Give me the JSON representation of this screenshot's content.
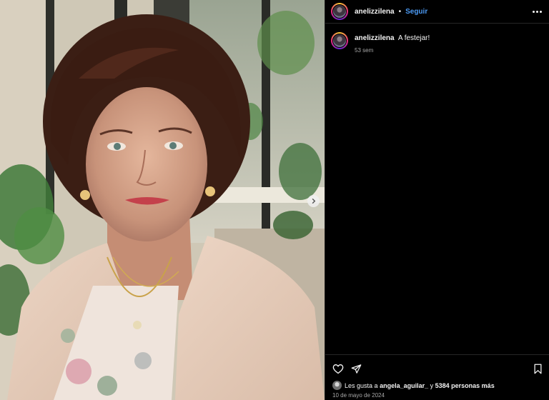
{
  "post": {
    "username": "anelizzilena",
    "separator": "•",
    "follow_label": "Seguir",
    "more_icon": "more-options-icon",
    "caption": {
      "username": "anelizzilena",
      "text": "A festejar!",
      "time": "53 sem"
    },
    "actions": {
      "like_icon": "heart-icon",
      "share_icon": "send-icon",
      "save_icon": "bookmark-icon"
    },
    "likes": {
      "prefix": "Les gusta a",
      "user": "angela_aguilar_",
      "middle": "y",
      "others": "5384 personas más"
    },
    "date": "10 de mayo de 2024"
  },
  "carousel": {
    "next_icon": "chevron-right-icon"
  },
  "colors": {
    "background": "#000000",
    "link_blue": "#4c9bf5",
    "secondary_text": "#a8a8a8",
    "divider": "#262626"
  }
}
